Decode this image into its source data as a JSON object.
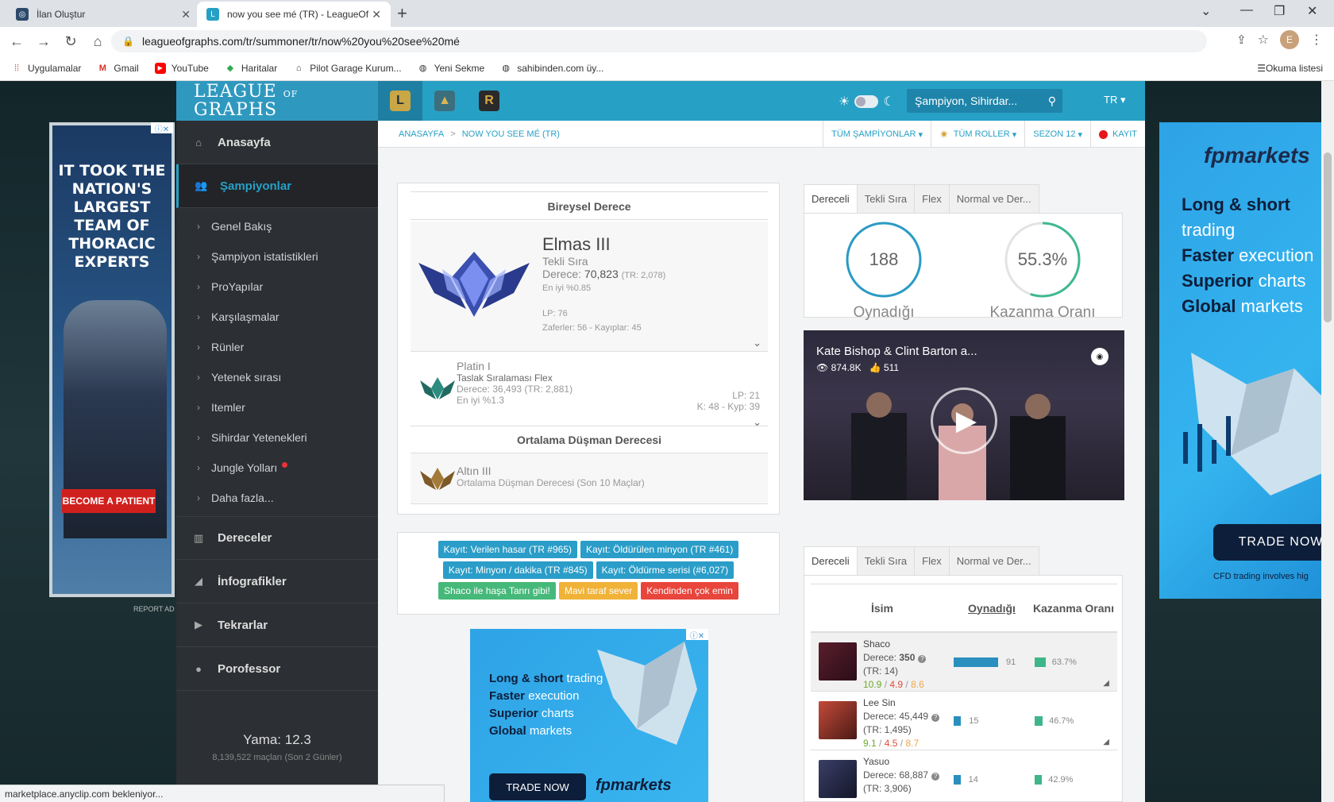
{
  "browser": {
    "tabs": [
      {
        "title": "İlan Oluştur",
        "active": false
      },
      {
        "title": "now you see mé (TR) - LeagueOf",
        "active": true
      }
    ],
    "url": "leagueofgraphs.com/tr/summoner/tr/now%20you%20see%20mé",
    "profile_initial": "E",
    "bookmarks": [
      "Uygulamalar",
      "Gmail",
      "YouTube",
      "Haritalar",
      "Pilot Garage Kurum...",
      "Yeni Sekme",
      "sahibinden.com üy..."
    ],
    "reading_list": "Okuma listesi",
    "status_text": "marketplace.anyclip.com bekleniyor..."
  },
  "site": {
    "logo_line1": "LEAGUE",
    "logo_of": "OF",
    "logo_line2": "GRAPHS",
    "search_placeholder": "Şampiyon, Sihirdar...",
    "lang": "TR"
  },
  "sidebar": {
    "top": [
      {
        "label": "Anasayfa",
        "icon": "home-icon"
      },
      {
        "label": "Şampiyonlar",
        "icon": "users-icon",
        "active": true
      }
    ],
    "sub": [
      "Genel Bakış",
      "Şampiyon istatistikleri",
      "ProYapılar",
      "Karşılaşmalar",
      "Rünler",
      "Yetenek sırası",
      "Itemler",
      "Sihirdar Yetenekleri",
      "Jungle Yolları",
      "Daha fazla..."
    ],
    "bottom": [
      {
        "label": "Dereceler"
      },
      {
        "label": "İnfografikler"
      },
      {
        "label": "Tekrarlar"
      },
      {
        "label": "Porofessor"
      }
    ],
    "patch": "Yama: 12.3",
    "games": "8,139,522 maçları (Son 2 Günler)"
  },
  "breadcrumb": {
    "home": "ANASAYFA",
    "current": "NOW YOU SEE MÉ (TR)"
  },
  "filters": {
    "champions": "TÜM ŞAMPİYONLAR",
    "roles": "TÜM ROLLER",
    "season": "SEZON 12",
    "record": "KAYIT"
  },
  "rank": {
    "header": "Bireysel Derece",
    "solo": {
      "tier": "Elmas III",
      "queue": "Tekli Sıra",
      "ladder_label": "Derece:",
      "ladder": "70,823",
      "ladder_tr": "(TR: 2,078)",
      "top": "En iyi %0.85",
      "lp": "LP: 76",
      "record": "Zaferler: 56 - Kayıplar: 45"
    },
    "flex": {
      "tier": "Platin I",
      "queue": "Taslak Sıralaması Flex",
      "ladder": "Derece: 36,493 (TR: 2,881)",
      "top": "En iyi %1.3",
      "lp": "LP: 21",
      "record": "K: 48 - Kyp: 39"
    },
    "avg_header": "Ortalama Düşman Derecesi",
    "avg": {
      "tier": "Altın III",
      "desc": "Ortalama Düşman Derecesi (Son 10 Maçlar)"
    }
  },
  "tags": [
    [
      {
        "text": "Kayıt: Verilen hasar (TR #965)",
        "color": "blue"
      },
      {
        "text": "Kayıt: Öldürülen minyon (TR #461)",
        "color": "blue"
      }
    ],
    [
      {
        "text": "Kayıt: Minyon / dakika (TR #845)",
        "color": "blue"
      },
      {
        "text": "Kayıt: Öldürme serisi (#6,027)",
        "color": "blue"
      }
    ],
    [
      {
        "text": "Shaco ile haşa Tanrı gibi!",
        "color": "green"
      },
      {
        "text": "Mavi taraf sever",
        "color": "yellow"
      },
      {
        "text": "Kendinden çok emin",
        "color": "red"
      }
    ]
  ],
  "queue_tabs": [
    "Dereceli",
    "Tekli Sıra",
    "Flex",
    "Normal ve Der..."
  ],
  "stats": {
    "played": 188,
    "played_label": "Oynadığı",
    "winrate": 55.3,
    "winrate_text": "55.3%",
    "winrate_label": "Kazanma Oranı"
  },
  "video": {
    "title": "Kate Bishop & Clint Barton a...",
    "views": "874.8K",
    "likes": "511"
  },
  "champs": {
    "headers": {
      "name": "İsim",
      "played": "Oynadığı",
      "winrate": "Kazanma Oranı"
    },
    "rows": [
      {
        "name": "Shaco",
        "rank_label": "Derece:",
        "rank": "350",
        "rank_tr": "(TR: 14)",
        "k": "10.9",
        "d": "4.9",
        "a": "8.6",
        "played": 91,
        "winrate": 63.7,
        "winrate_text": "63.7%"
      },
      {
        "name": "Lee Sin",
        "rank_label": "Derece:",
        "rank": "45,449",
        "rank_tr": "(TR: 1,495)",
        "k": "9.1",
        "d": "4.5",
        "a": "8.7",
        "played": 15,
        "winrate": 46.7,
        "winrate_text": "46.7%"
      },
      {
        "name": "Yasuo",
        "rank_label": "Derece:",
        "rank": "68,887",
        "rank_tr": "(TR: 3,906)",
        "k": "",
        "d": "",
        "a": "",
        "played": 14,
        "winrate": 42.9,
        "winrate_text": "42.9%"
      }
    ]
  },
  "ads": {
    "left": {
      "text": "IT TOOK THE NATION'S LARGEST TEAM OF THORACIC EXPERTS",
      "cta": "BECOME A PATIENT",
      "report": "REPORT AD"
    },
    "fp": {
      "logo": "fpmarkets",
      "l1b": "Long & short",
      "l1": "trading",
      "l2b": "Faster",
      "l2": "execution",
      "l3b": "Superior",
      "l3": "charts",
      "l4b": "Global",
      "l4": "markets",
      "cta": "TRADE NOW",
      "disclaimer": "CFD trading involves hig"
    }
  }
}
